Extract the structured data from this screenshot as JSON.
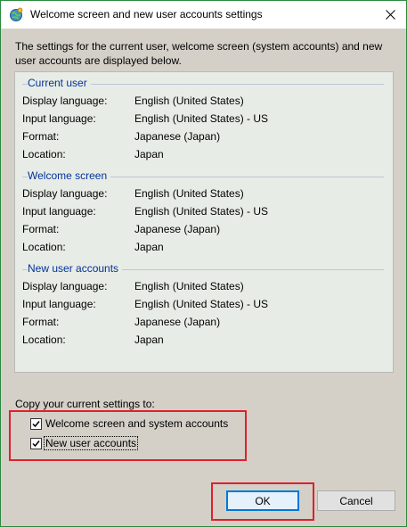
{
  "window": {
    "title": "Welcome screen and new user accounts settings",
    "close_glyph": "✕"
  },
  "intro": "The settings for the current user, welcome screen (system accounts) and new user accounts are displayed below.",
  "sections": [
    {
      "heading": "Current user",
      "rows": [
        {
          "key": "Display language:",
          "value": "English (United States)"
        },
        {
          "key": "Input language:",
          "value": "English (United States) - US"
        },
        {
          "key": "Format:",
          "value": "Japanese (Japan)"
        },
        {
          "key": "Location:",
          "value": "Japan"
        }
      ]
    },
    {
      "heading": "Welcome screen",
      "rows": [
        {
          "key": "Display language:",
          "value": "English (United States)"
        },
        {
          "key": "Input language:",
          "value": "English (United States) - US"
        },
        {
          "key": "Format:",
          "value": "Japanese (Japan)"
        },
        {
          "key": "Location:",
          "value": "Japan"
        }
      ]
    },
    {
      "heading": "New user accounts",
      "rows": [
        {
          "key": "Display language:",
          "value": "English (United States)"
        },
        {
          "key": "Input language:",
          "value": "English (United States) - US"
        },
        {
          "key": "Format:",
          "value": "Japanese (Japan)"
        },
        {
          "key": "Location:",
          "value": "Japan"
        }
      ]
    }
  ],
  "copy": {
    "label": "Copy your current settings to:",
    "options": [
      {
        "label": "Welcome screen and system accounts",
        "checked": true
      },
      {
        "label": "New user accounts",
        "checked": true
      }
    ]
  },
  "buttons": {
    "ok": "OK",
    "cancel": "Cancel"
  },
  "colors": {
    "highlight_box": "#e0202c",
    "section_heading": "#003399",
    "default_button_border": "#0078d7"
  },
  "icons": {
    "title": "globe-settings-icon",
    "close": "close-icon",
    "checkbox": "checkmark-icon"
  }
}
